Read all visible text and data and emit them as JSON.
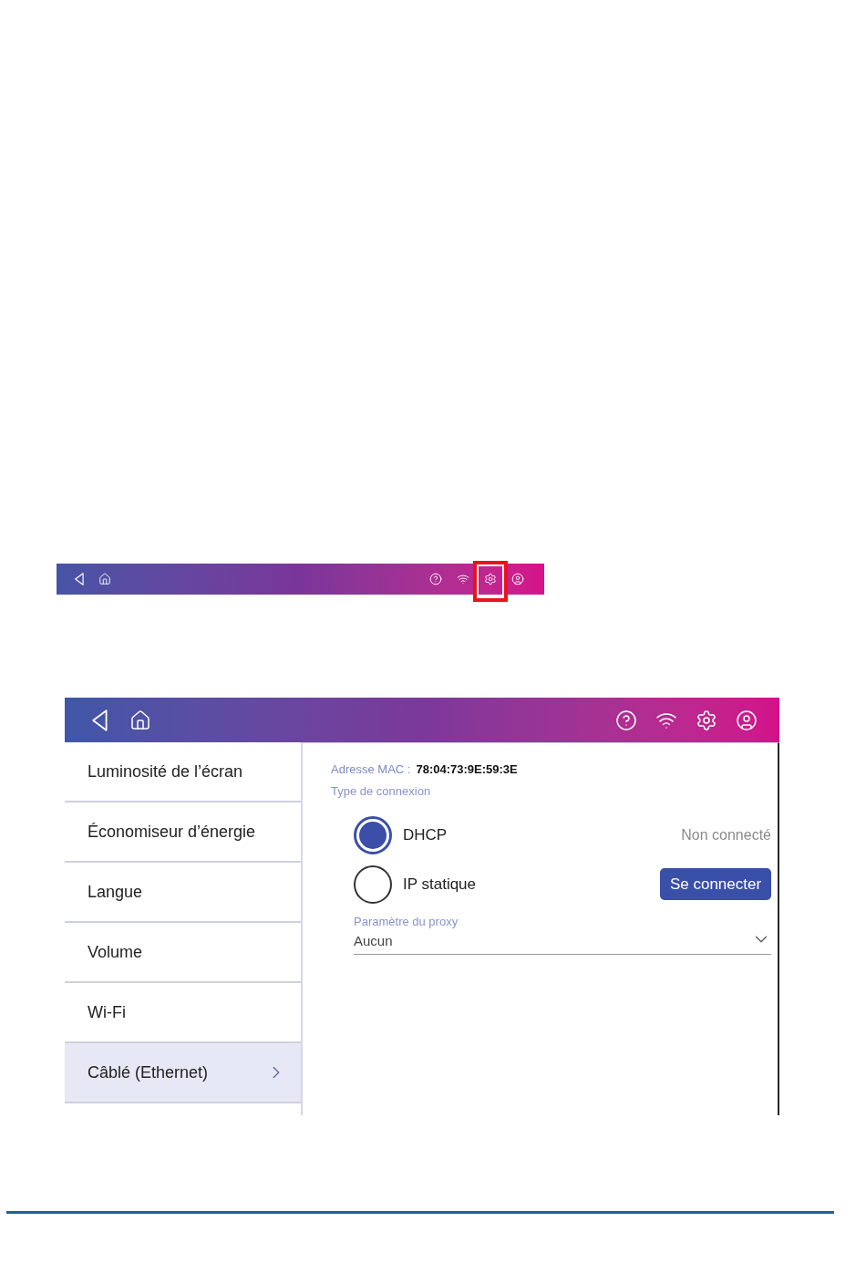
{
  "callout_bar": {
    "settings_highlighted": true
  },
  "sidebar": {
    "items": [
      {
        "label": "Luminosité de l’écran",
        "selected": false
      },
      {
        "label": "Économiseur d’énergie",
        "selected": false
      },
      {
        "label": "Langue",
        "selected": false
      },
      {
        "label": "Volume",
        "selected": false
      },
      {
        "label": "Wi-Fi",
        "selected": false
      },
      {
        "label": "Câblé (Ethernet)",
        "selected": true
      }
    ]
  },
  "mac_address": {
    "label": "Adresse MAC :",
    "value": "78:04:73:9E:59:3E"
  },
  "connection_type": {
    "label": "Type de connexion",
    "options": [
      {
        "label": "DHCP",
        "selected": true
      },
      {
        "label": "IP statique",
        "selected": false
      }
    ]
  },
  "status": "Non connecté",
  "connect_button": "Se connecter",
  "proxy": {
    "label": "Paramètre du proxy",
    "value": "Aucun"
  }
}
